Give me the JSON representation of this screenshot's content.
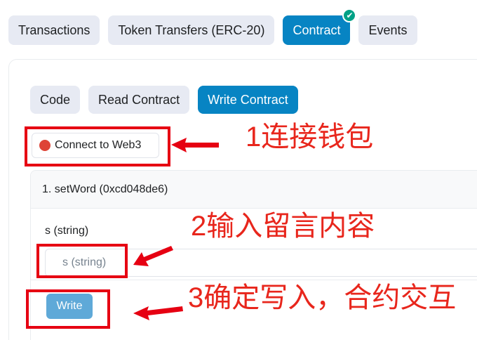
{
  "tabs": [
    {
      "label": "Transactions"
    },
    {
      "label": "Token Transfers (ERC-20)"
    },
    {
      "label": "Contract",
      "active": true,
      "badge": "✔"
    },
    {
      "label": "Events"
    }
  ],
  "subtabs": [
    {
      "label": "Code"
    },
    {
      "label": "Read Contract"
    },
    {
      "label": "Write Contract",
      "active": true
    }
  ],
  "connect": {
    "label": "Connect to Web3",
    "status_color": "#de4437"
  },
  "method": {
    "title": "1. setWord (0xcd048de6)",
    "param_label": "s (string)",
    "param_placeholder": "s (string)",
    "write_label": "Write"
  },
  "annotations": {
    "step1": "1连接钱包",
    "step2": "2输入留言内容",
    "step3": "3确定写入，合约交互"
  },
  "colors": {
    "accent": "#0784c3",
    "annotation_red": "#e60012",
    "check": "#00a186"
  }
}
